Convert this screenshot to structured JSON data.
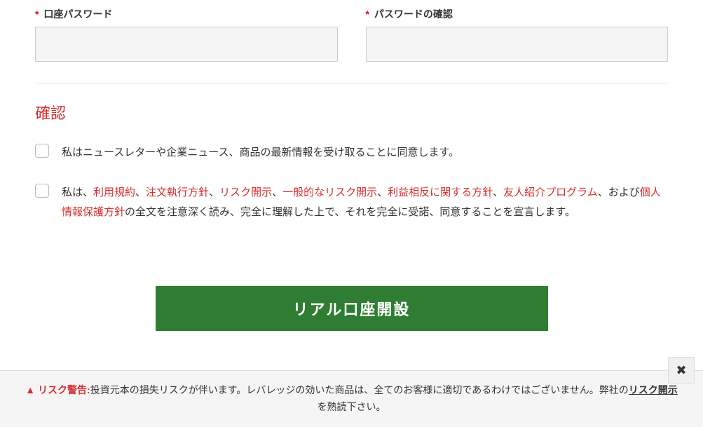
{
  "fields": {
    "password": {
      "label": "口座パスワード"
    },
    "password_confirm": {
      "label": "パスワードの確認"
    }
  },
  "section": {
    "title": "確認"
  },
  "checkbox1": {
    "text": "私はニュースレターや企業ニュース、商品の最新情報を受け取ることに同意します。"
  },
  "checkbox2": {
    "prefix": "私は、",
    "links": {
      "terms": "利用規約",
      "order_exec": "注文執行方針",
      "risk_disc": "リスク開示",
      "general_risk": "一般的なリスク開示",
      "conflict": "利益相反に関する方針",
      "referral": "友人紹介プログラム",
      "privacy": "個人情報保護方針"
    },
    "sep1": "、",
    "sep_and": "、および",
    "suffix": "の全文を注意深く読み、完全に理解した上で、それを完全に受諾、同意することを宣言します。"
  },
  "submit": {
    "label": "リアル口座開設"
  },
  "risk": {
    "title": "リスク警告:",
    "text1": "投資元本の損失リスクが伴います。レバレッジの効いた商品は、全てのお客様に適切であるわけではございません。弊社の",
    "link": "リスク開示",
    "text2": "を熟読下さい。",
    "close": "✖"
  }
}
